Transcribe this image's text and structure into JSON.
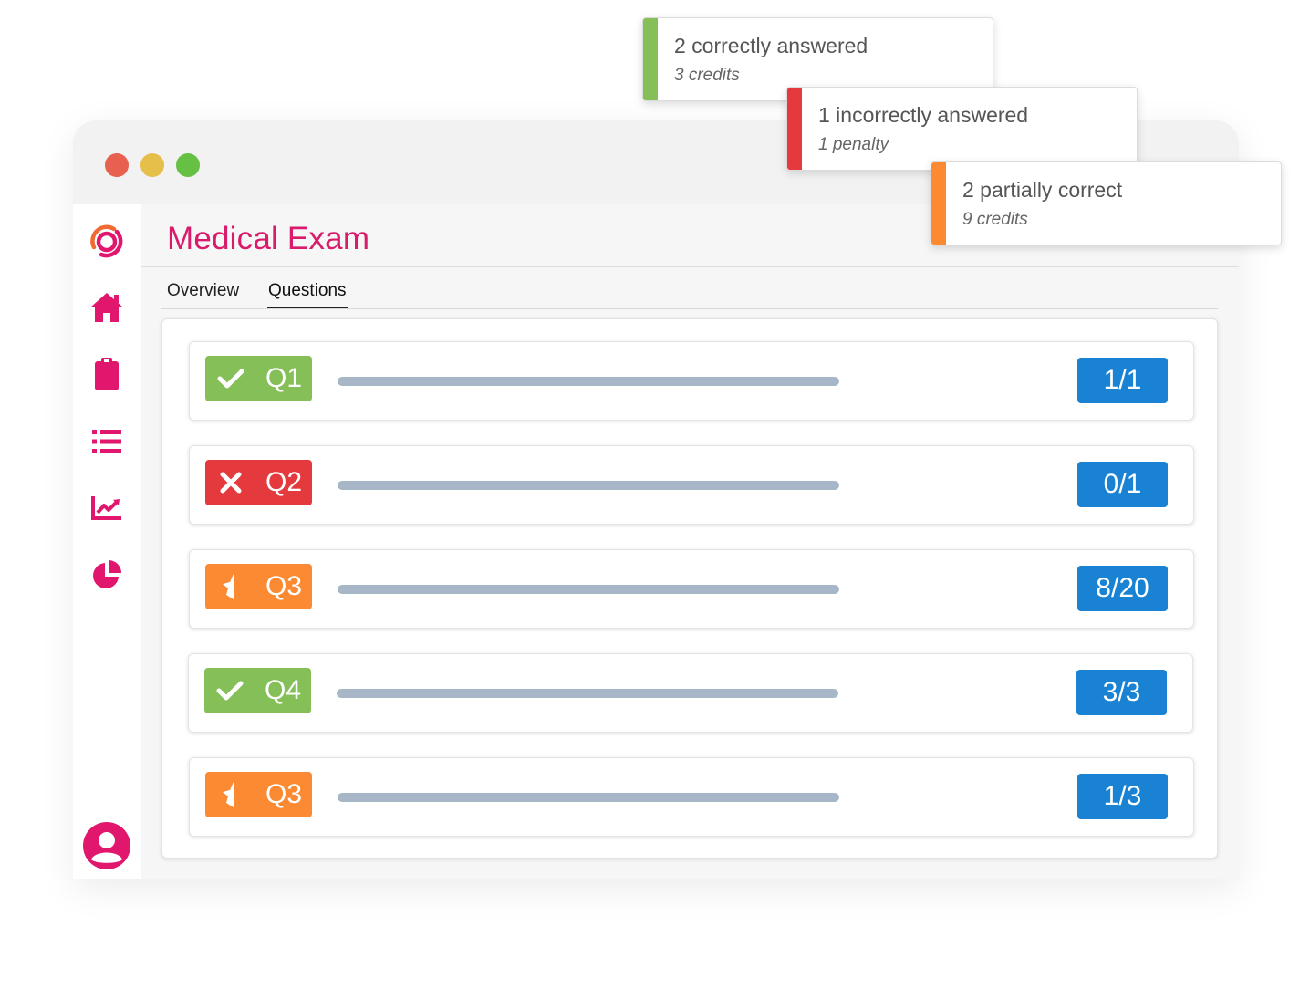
{
  "app": {
    "title": "Medical Exam",
    "tabs": [
      {
        "label": "Overview",
        "active": false
      },
      {
        "label": "Questions",
        "active": true
      }
    ]
  },
  "sidebar": {
    "items": [
      {
        "icon": "logo-icon"
      },
      {
        "icon": "home-icon"
      },
      {
        "icon": "clipboard-icon"
      },
      {
        "icon": "list-icon"
      },
      {
        "icon": "chart-line-icon"
      },
      {
        "icon": "pie-chart-icon"
      },
      {
        "icon": "user-avatar-icon"
      }
    ],
    "accent_color": "#e0176d"
  },
  "questions": [
    {
      "label": "Q1",
      "status": "correct",
      "icon": "check-icon",
      "score": "1/1"
    },
    {
      "label": "Q2",
      "status": "incorrect",
      "icon": "cross-icon",
      "score": "0/1"
    },
    {
      "label": "Q3",
      "status": "partial",
      "icon": "half-star-icon",
      "score": "8/20"
    },
    {
      "label": "Q4",
      "status": "correct",
      "icon": "check-icon",
      "score": "3/3"
    },
    {
      "label": "Q3",
      "status": "partial",
      "icon": "half-star-icon",
      "score": "1/3"
    }
  ],
  "status_colors": {
    "correct": "#85bf57",
    "incorrect": "#e43a3e",
    "partial": "#fb8a33",
    "score": "#1a82d3"
  },
  "toasts": [
    {
      "title": "2 correctly answered",
      "subtitle": "3 credits",
      "status": "correct"
    },
    {
      "title": "1 incorrectly answered",
      "subtitle": "1 penalty",
      "status": "incorrect"
    },
    {
      "title": "2 partially correct",
      "subtitle": "9 credits",
      "status": "partial"
    }
  ]
}
